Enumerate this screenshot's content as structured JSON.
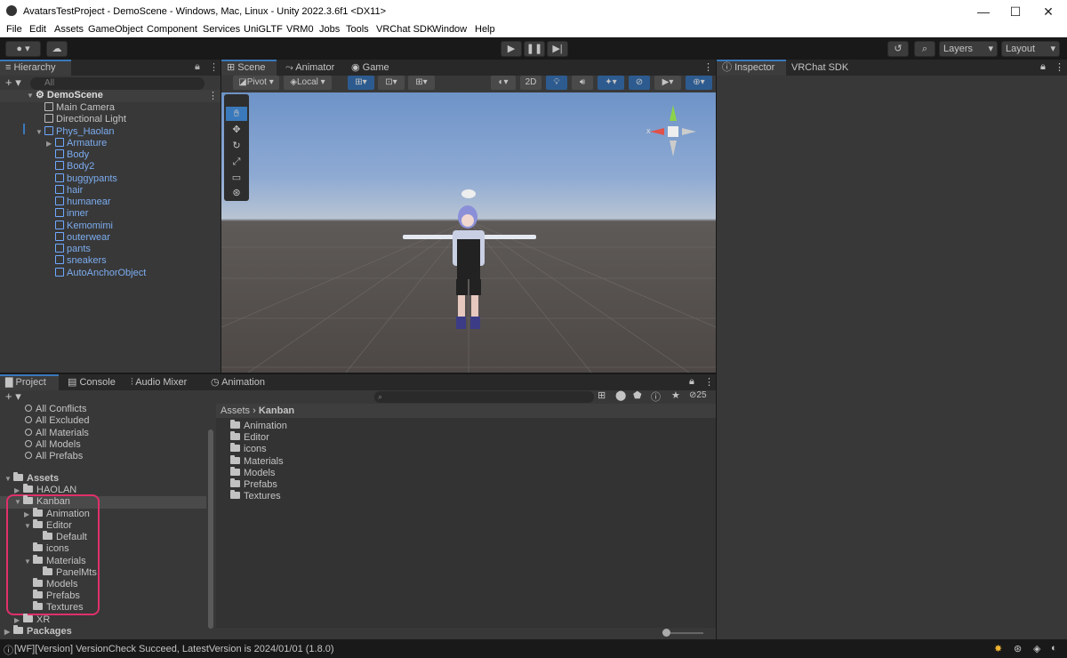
{
  "window": {
    "title": "AvatarsTestProject - DemoScene - Windows, Mac, Linux - Unity 2022.3.6f1 <DX11>",
    "min": "—",
    "max": "☐",
    "close": "✕"
  },
  "menu": [
    "File",
    "Edit",
    "Assets",
    "GameObject",
    "Component",
    "Services",
    "UniGLTF",
    "VRM0",
    "Jobs",
    "Tools",
    "VRChat SDK",
    "Window",
    "Help"
  ],
  "toolbar": {
    "layers": "Layers",
    "layout": "Layout"
  },
  "hierarchy": {
    "tab": "Hierarchy",
    "search_placeholder": "All",
    "scene": "DemoScene",
    "items": [
      {
        "label": "Main Camera",
        "indent": 1,
        "blue": false
      },
      {
        "label": "Directional Light",
        "indent": 1,
        "blue": false
      },
      {
        "label": "Phys_Haolan",
        "indent": 1,
        "blue": true
      },
      {
        "label": "Armature",
        "indent": 2,
        "blue": true
      },
      {
        "label": "Body",
        "indent": 2,
        "blue": true
      },
      {
        "label": "Body2",
        "indent": 2,
        "blue": true
      },
      {
        "label": "buggypants",
        "indent": 2,
        "blue": true
      },
      {
        "label": "hair",
        "indent": 2,
        "blue": true
      },
      {
        "label": "humanear",
        "indent": 2,
        "blue": true
      },
      {
        "label": "inner",
        "indent": 2,
        "blue": true
      },
      {
        "label": "Kemomimi",
        "indent": 2,
        "blue": true
      },
      {
        "label": "outerwear",
        "indent": 2,
        "blue": true
      },
      {
        "label": "pants",
        "indent": 2,
        "blue": true
      },
      {
        "label": "sneakers",
        "indent": 2,
        "blue": true
      },
      {
        "label": "AutoAnchorObject",
        "indent": 2,
        "blue": true
      }
    ]
  },
  "scene_tabs": {
    "scene": "Scene",
    "animator": "Animator",
    "game": "Game",
    "pivot": "Pivot",
    "local": "Local",
    "two_d": "2D",
    "gizmo_x": "x"
  },
  "inspector_tabs": {
    "inspector": "Inspector",
    "vrchat": "VRChat SDK"
  },
  "project_tabs": {
    "project": "Project",
    "console": "Console",
    "audio": "Audio Mixer",
    "animation": "Animation",
    "hidden_count": "25"
  },
  "favorites": [
    "All Conflicts",
    "All Excluded",
    "All Materials",
    "All Models",
    "All Prefabs"
  ],
  "tree": [
    {
      "label": "Assets",
      "indent": 0,
      "bold": true,
      "arrow": "▼"
    },
    {
      "label": "HAOLAN",
      "indent": 1,
      "bold": false,
      "arrow": "▶"
    },
    {
      "label": "Kanban",
      "indent": 1,
      "bold": false,
      "arrow": "▼"
    },
    {
      "label": "Animation",
      "indent": 2,
      "bold": false,
      "arrow": "▶"
    },
    {
      "label": "Editor",
      "indent": 2,
      "bold": false,
      "arrow": "▼"
    },
    {
      "label": "Default",
      "indent": 3,
      "bold": false,
      "arrow": ""
    },
    {
      "label": "icons",
      "indent": 2,
      "bold": false,
      "arrow": ""
    },
    {
      "label": "Materials",
      "indent": 2,
      "bold": false,
      "arrow": "▼"
    },
    {
      "label": "PanelMts",
      "indent": 3,
      "bold": false,
      "arrow": ""
    },
    {
      "label": "Models",
      "indent": 2,
      "bold": false,
      "arrow": ""
    },
    {
      "label": "Prefabs",
      "indent": 2,
      "bold": false,
      "arrow": ""
    },
    {
      "label": "Textures",
      "indent": 2,
      "bold": false,
      "arrow": ""
    },
    {
      "label": "XR",
      "indent": 1,
      "bold": false,
      "arrow": "▶"
    },
    {
      "label": "Packages",
      "indent": 0,
      "bold": true,
      "arrow": "▶"
    }
  ],
  "breadcrumb": {
    "root": "Assets",
    "sep": "›",
    "current": "Kanban"
  },
  "folder_items": [
    "Animation",
    "Editor",
    "icons",
    "Materials",
    "Models",
    "Prefabs",
    "Textures"
  ],
  "status": "[WF][Version] VersionCheck Succeed, LatestVersion is 2024/01/01 (1.8.0)"
}
